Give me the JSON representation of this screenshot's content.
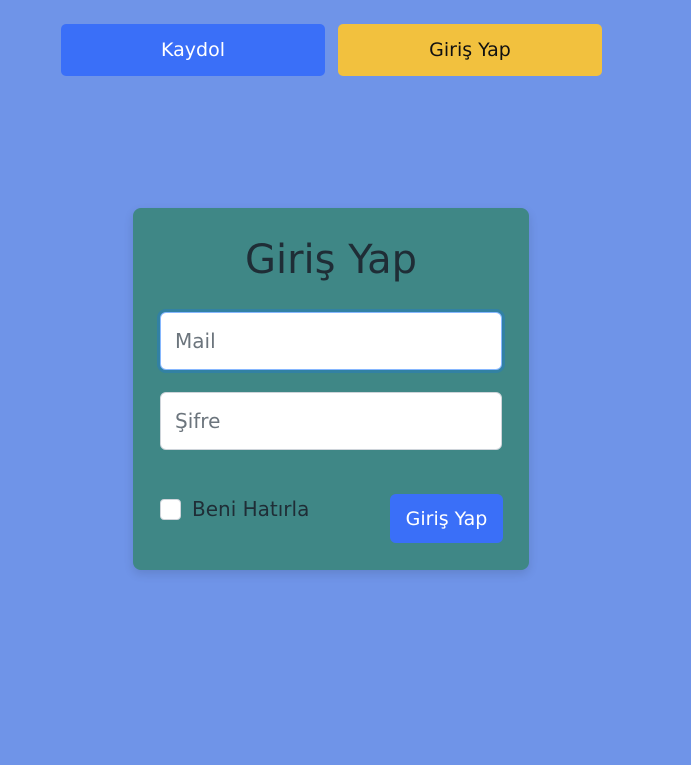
{
  "header": {
    "register_label": "Kaydol",
    "login_label": "Giriş Yap"
  },
  "login_card": {
    "title": "Giriş Yap",
    "mail_placeholder": "Mail",
    "mail_value": "",
    "password_placeholder": "Şifre",
    "password_value": "",
    "remember_label": "Beni Hatırla",
    "remember_checked": false,
    "submit_label": "Giriş Yap"
  },
  "colors": {
    "background": "#6f94e8",
    "primary": "#3a6ff8",
    "warning": "#f2c13e",
    "card": "#3f8786",
    "title_text": "#1f2d36"
  }
}
